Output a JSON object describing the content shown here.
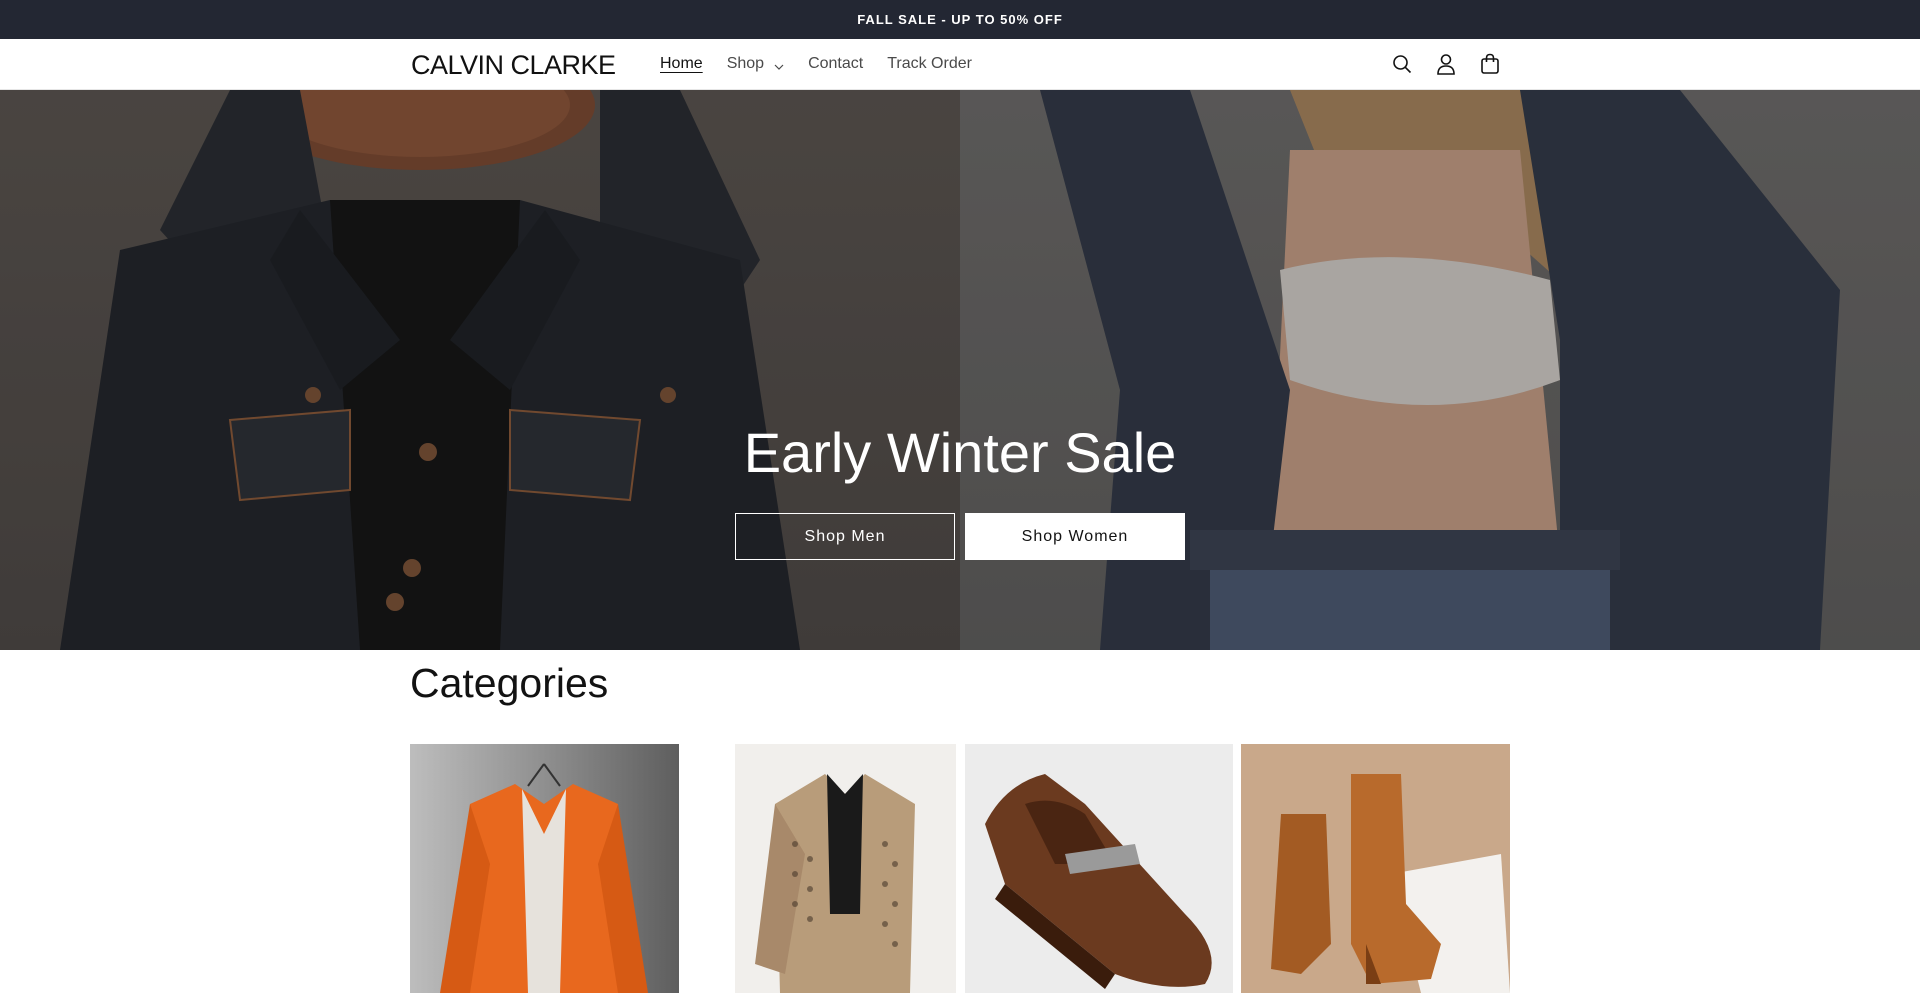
{
  "announcement": {
    "text": "FALL SALE - UP TO 50% OFF"
  },
  "header": {
    "logo": "CALVIN CLARKE",
    "nav": [
      {
        "label": "Home",
        "active": true
      },
      {
        "label": "Shop",
        "has_dropdown": true
      },
      {
        "label": "Contact"
      },
      {
        "label": "Track Order"
      }
    ],
    "icons": [
      "search-icon",
      "account-icon",
      "cart-icon"
    ]
  },
  "hero": {
    "title": "Early Winter Sale",
    "buttons": [
      {
        "label": "Shop Men",
        "style": "outline"
      },
      {
        "label": "Shop Women",
        "style": "solid"
      }
    ]
  },
  "categories": {
    "title": "Categories",
    "tiles": [
      {
        "image": "orange-hooded-sweater"
      },
      {
        "image": "houndstooth-jacket"
      },
      {
        "image": "brown-leather-loafer"
      },
      {
        "image": "tan-ankle-boots"
      }
    ]
  },
  "colors": {
    "announcement_bg": "#232733",
    "text": "#121212",
    "accent_orange": "#e8681e"
  }
}
